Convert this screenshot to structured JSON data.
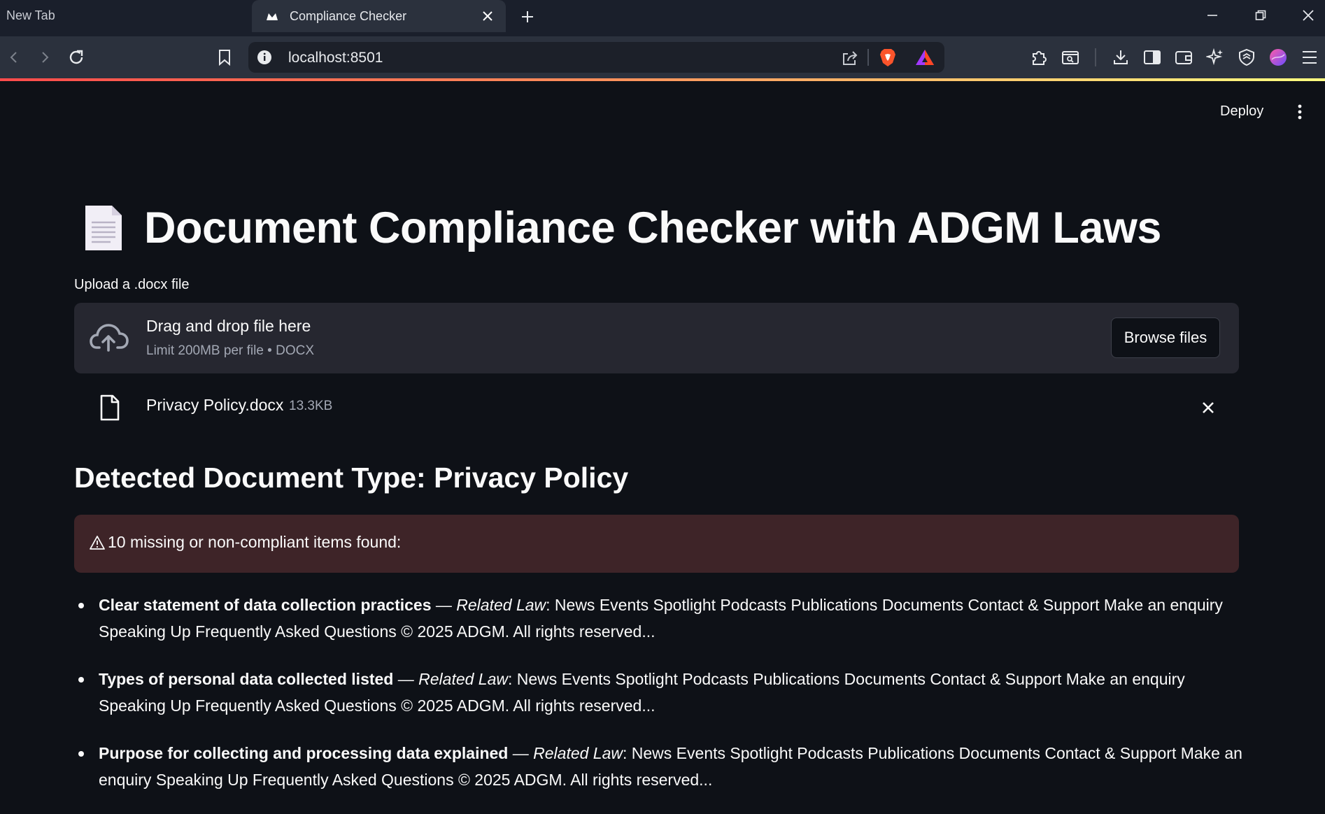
{
  "browser": {
    "inactive_tab_title": "New Tab",
    "active_tab_title": "Compliance Checker",
    "url": "localhost:8501"
  },
  "app": {
    "deploy_label": "Deploy",
    "title": "Document Compliance Checker with ADGM Laws",
    "uploader": {
      "label": "Upload a .docx file",
      "drop_text": "Drag and drop file here",
      "limit_text": "Limit 200MB per file • DOCX",
      "browse_label": "Browse files"
    },
    "uploaded_file": {
      "name": "Privacy Policy.docx",
      "size": "13.3KB"
    },
    "detected_type_heading": "Detected Document Type: Privacy Policy",
    "alert_text": "10 missing or non-compliant items found:",
    "results": [
      {
        "item": "Clear statement of data collection practices",
        "separator": " — ",
        "law_label": "Related Law",
        "law_text": ": News Events Spotlight Podcasts Publications Documents Contact & Support Make an enquiry Speaking Up Frequently Asked Questions © 2025 ADGM. All rights reserved..."
      },
      {
        "item": "Types of personal data collected listed",
        "separator": " — ",
        "law_label": "Related Law",
        "law_text": ": News Events Spotlight Podcasts Publications Documents Contact & Support Make an enquiry Speaking Up Frequently Asked Questions © 2025 ADGM. All rights reserved..."
      },
      {
        "item": "Purpose for collecting and processing data explained",
        "separator": " — ",
        "law_label": "Related Law",
        "law_text": ": News Events Spotlight Podcasts Publications Documents Contact & Support Make an enquiry Speaking Up Frequently Asked Questions © 2025 ADGM. All rights reserved..."
      }
    ]
  },
  "colors": {
    "app_background": "#0e1117",
    "dropzone_background": "#262730",
    "alert_background": "#3e2428",
    "accent_red": "#ff4b4b"
  }
}
